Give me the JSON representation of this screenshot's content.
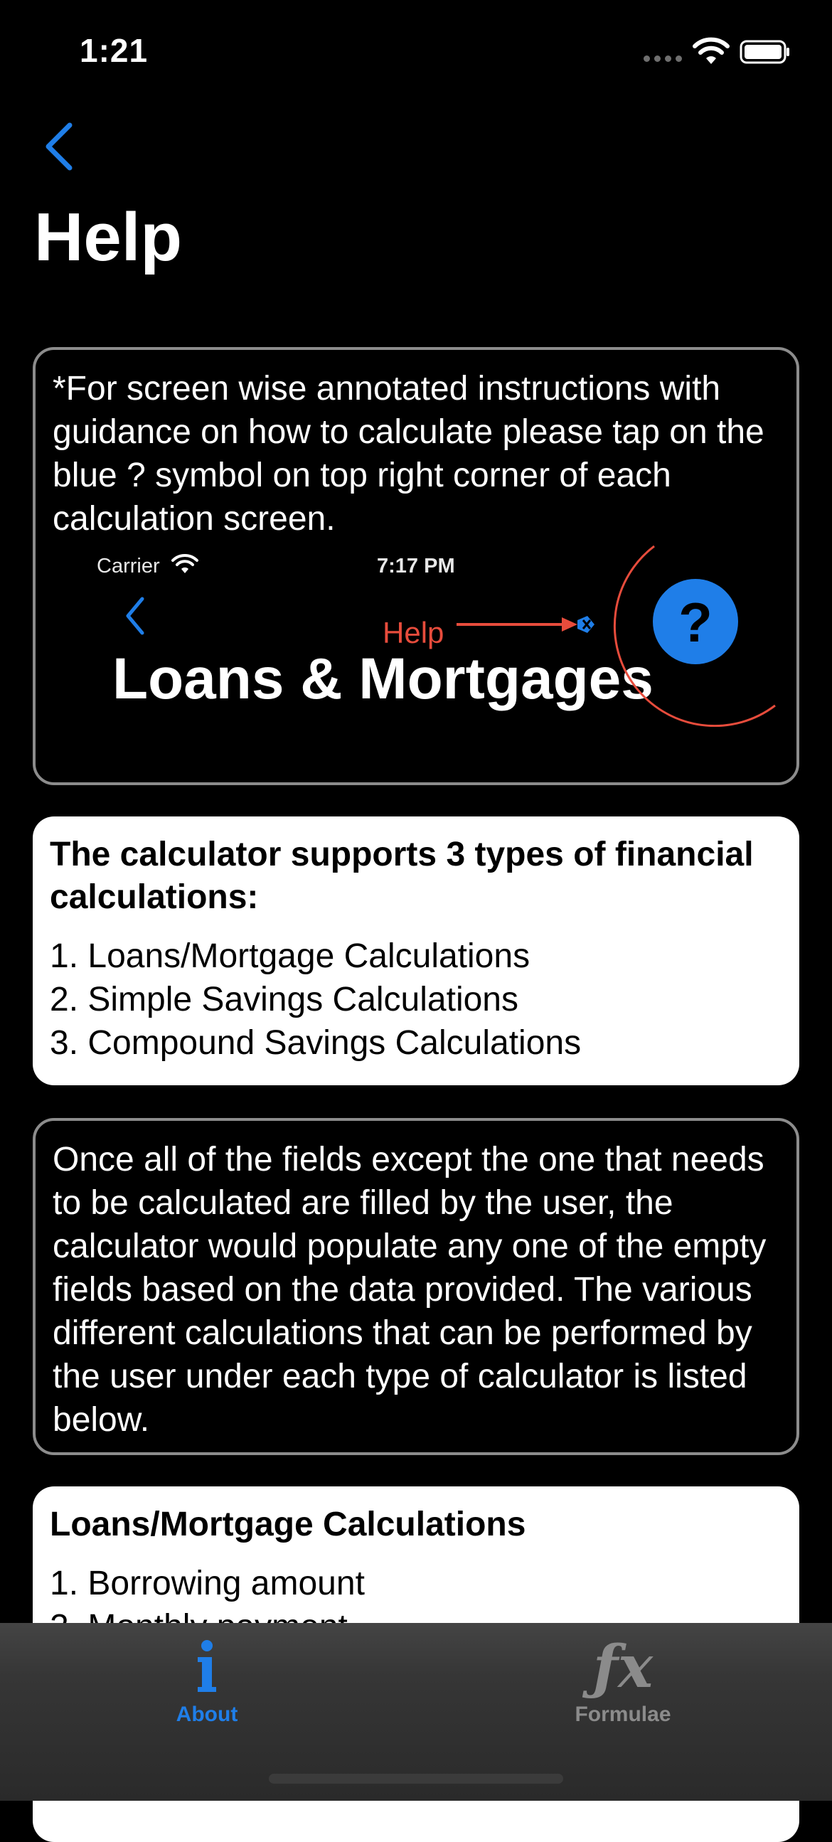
{
  "status_bar": {
    "time": "1:21"
  },
  "nav": {
    "title": "Help"
  },
  "intro_card": {
    "text": "*For screen wise annotated instructions with guidance on how to calculate please tap on the blue ? symbol on top right corner of each calculation screen.",
    "illustration": {
      "carrier": "Carrier",
      "time": "7:17 PM",
      "help_label": "Help",
      "screen_title": "Loans & Mortgages",
      "help_button_glyph": "?",
      "colors": {
        "accent": "#1f7ee8",
        "annotation": "#e74c3c"
      }
    }
  },
  "types_card": {
    "heading": "The calculator supports 3 types of financial calculations:",
    "items": [
      "1. Loans/Mortgage Calculations",
      "2. Simple Savings Calculations",
      "3. Compound Savings Calculations"
    ]
  },
  "info_card": {
    "text": "Once all of the fields except the one that needs to be calculated are filled by the user, the calculator would populate any one of the empty fields based on the data provided. The  various different calculations that can be performed by the user under each type of calculator is listed below."
  },
  "loans_card": {
    "heading": "Loans/Mortgage Calculations",
    "items": [
      "1. Borrowing amount",
      "2. Monthly payment"
    ]
  },
  "tab_bar": {
    "tabs": [
      {
        "label": "About",
        "icon": "info-icon",
        "selected": true
      },
      {
        "label": "Formulae",
        "icon": "function-fx-icon",
        "selected": false
      }
    ]
  }
}
